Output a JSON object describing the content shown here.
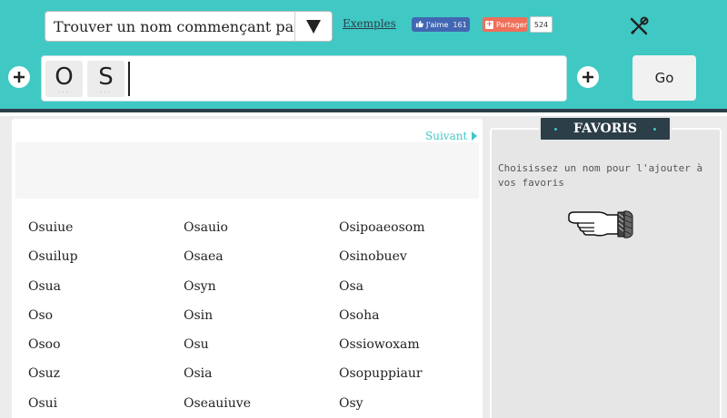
{
  "header": {
    "mode_select": "Trouver un nom commençant par...",
    "examples_link": "Exemples",
    "like_label": "J'aime",
    "like_count": "161",
    "share_label": "Partager",
    "share_count": "524",
    "tools_icon": "tools-icon"
  },
  "letters": {
    "tiles": [
      "O",
      "S"
    ],
    "tile_dots": "...",
    "go_label": "Go"
  },
  "results": {
    "next_label": "Suivant",
    "columns": [
      [
        "Osuiue",
        "Osuilup",
        "Osua",
        "Oso",
        "Osoo",
        "Osuz",
        "Osui"
      ],
      [
        "Osauio",
        "Osaea",
        "Osyn",
        "Osin",
        "Osu",
        "Osia",
        "Oseauiuve"
      ],
      [
        "Osipoaeosom",
        "Osinobuev",
        "Osa",
        "Osoha",
        "Ossiowoxam",
        "Osopuppiaur",
        "Osy"
      ]
    ]
  },
  "favorites": {
    "title": "FAVORIS",
    "hint": "Choisissez un nom pour l'ajouter à vos favoris"
  },
  "colors": {
    "teal": "#40c8c4",
    "dark": "#2c3e48",
    "facebook": "#4267b2",
    "share": "#ef6f5a"
  }
}
